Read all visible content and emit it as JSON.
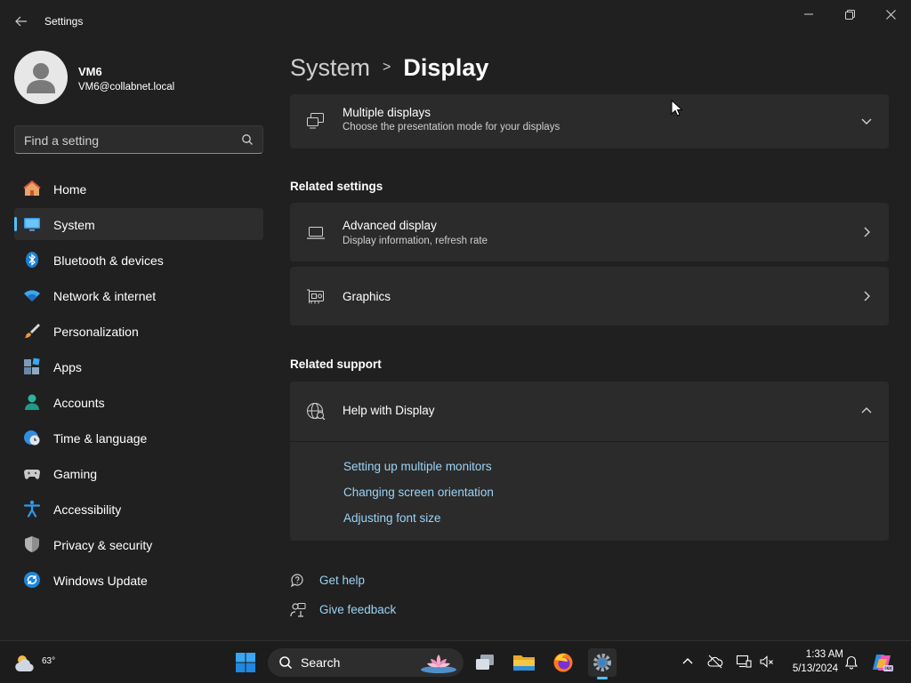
{
  "window": {
    "title": "Settings"
  },
  "profile": {
    "name": "VM6",
    "email": "VM6@collabnet.local"
  },
  "search": {
    "placeholder": "Find a setting"
  },
  "nav": [
    {
      "label": "Home",
      "icon": "home-icon"
    },
    {
      "label": "System",
      "icon": "system-icon",
      "selected": true
    },
    {
      "label": "Bluetooth & devices",
      "icon": "bluetooth-icon"
    },
    {
      "label": "Network & internet",
      "icon": "wifi-icon"
    },
    {
      "label": "Personalization",
      "icon": "brush-icon"
    },
    {
      "label": "Apps",
      "icon": "apps-icon"
    },
    {
      "label": "Accounts",
      "icon": "accounts-icon"
    },
    {
      "label": "Time & language",
      "icon": "globe-clock-icon"
    },
    {
      "label": "Gaming",
      "icon": "gamepad-icon"
    },
    {
      "label": "Accessibility",
      "icon": "accessibility-icon"
    },
    {
      "label": "Privacy & security",
      "icon": "shield-icon"
    },
    {
      "label": "Windows Update",
      "icon": "update-icon"
    }
  ],
  "breadcrumb": {
    "parent": "System",
    "separator": ">",
    "current": "Display"
  },
  "multiple_displays": {
    "title": "Multiple displays",
    "subtitle": "Choose the presentation mode for your displays"
  },
  "related_settings": {
    "heading": "Related settings",
    "items": [
      {
        "title": "Advanced display",
        "subtitle": "Display information, refresh rate"
      },
      {
        "title": "Graphics"
      }
    ]
  },
  "related_support": {
    "heading": "Related support",
    "help_title": "Help with Display",
    "links": [
      "Setting up multiple monitors",
      "Changing screen orientation",
      "Adjusting font size"
    ]
  },
  "footer": {
    "get_help": "Get help",
    "give_feedback": "Give feedback"
  },
  "taskbar": {
    "weather_temp": "63°",
    "search_label": "Search",
    "time": "1:33 AM",
    "date": "5/13/2024"
  },
  "colors": {
    "accent": "#4cc2ff",
    "link": "#9bd3f5",
    "background": "#202020",
    "card": "#2b2b2b"
  }
}
